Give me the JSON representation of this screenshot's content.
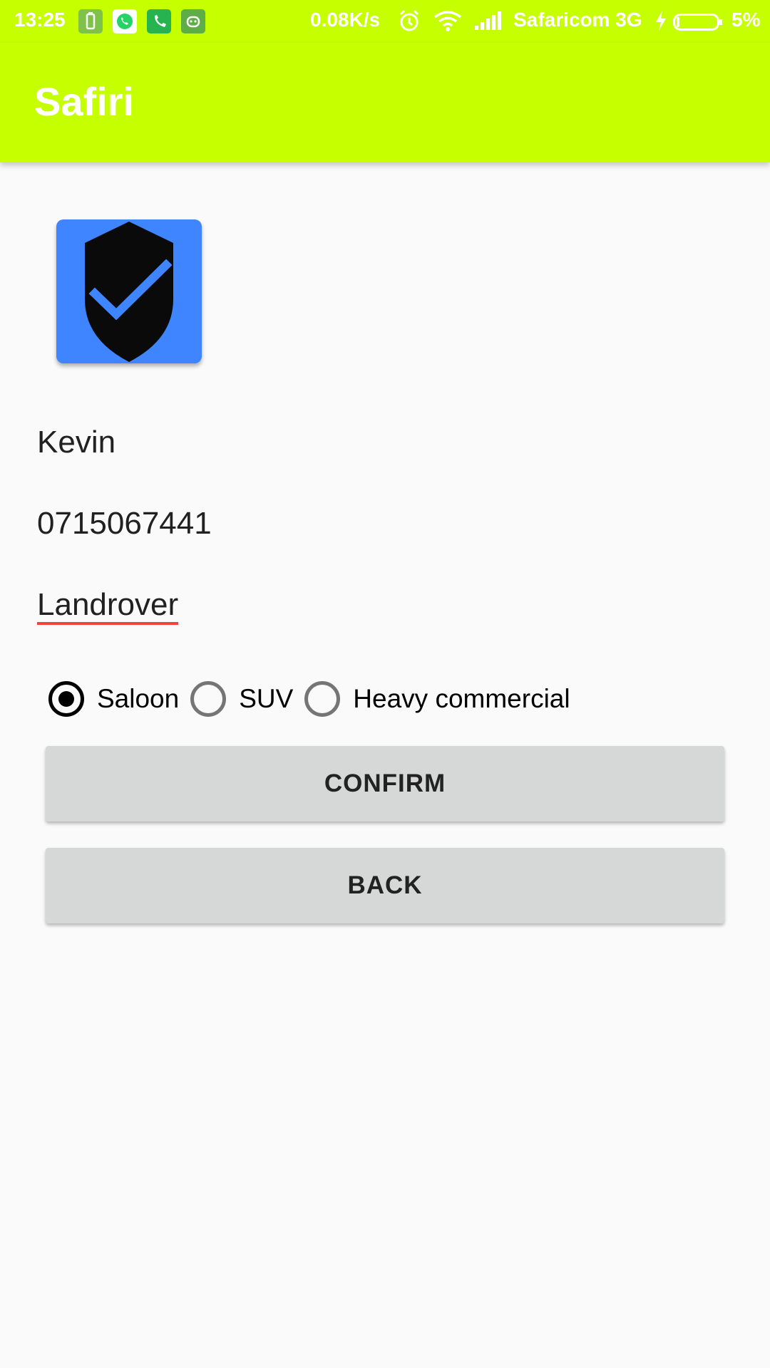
{
  "status_bar": {
    "time": "13:25",
    "network_speed": "0.08K/s",
    "carrier": "Safaricom 3G",
    "battery_percent": "5%",
    "notification_icons": [
      "battery-saver-icon",
      "whatsapp-icon",
      "phone-call-icon",
      "android-app-icon"
    ],
    "background_color": "#c6ff00"
  },
  "app_bar": {
    "title": "Safiri",
    "color": "#c6ff00"
  },
  "app_icon": {
    "icon": "shield-check-icon",
    "background_color": "#3f85ff",
    "shield_color": "#0a0a0a",
    "check_color": "#3f85ff"
  },
  "details": {
    "name": "Kevin",
    "phone": "0715067441",
    "vehicle": "Landrover"
  },
  "vehicle_type": {
    "options": [
      "Saloon",
      "SUV",
      "Heavy commercial"
    ],
    "selected": "Saloon"
  },
  "buttons": {
    "confirm_label": "CONFIRM",
    "back_label": "BACK"
  }
}
